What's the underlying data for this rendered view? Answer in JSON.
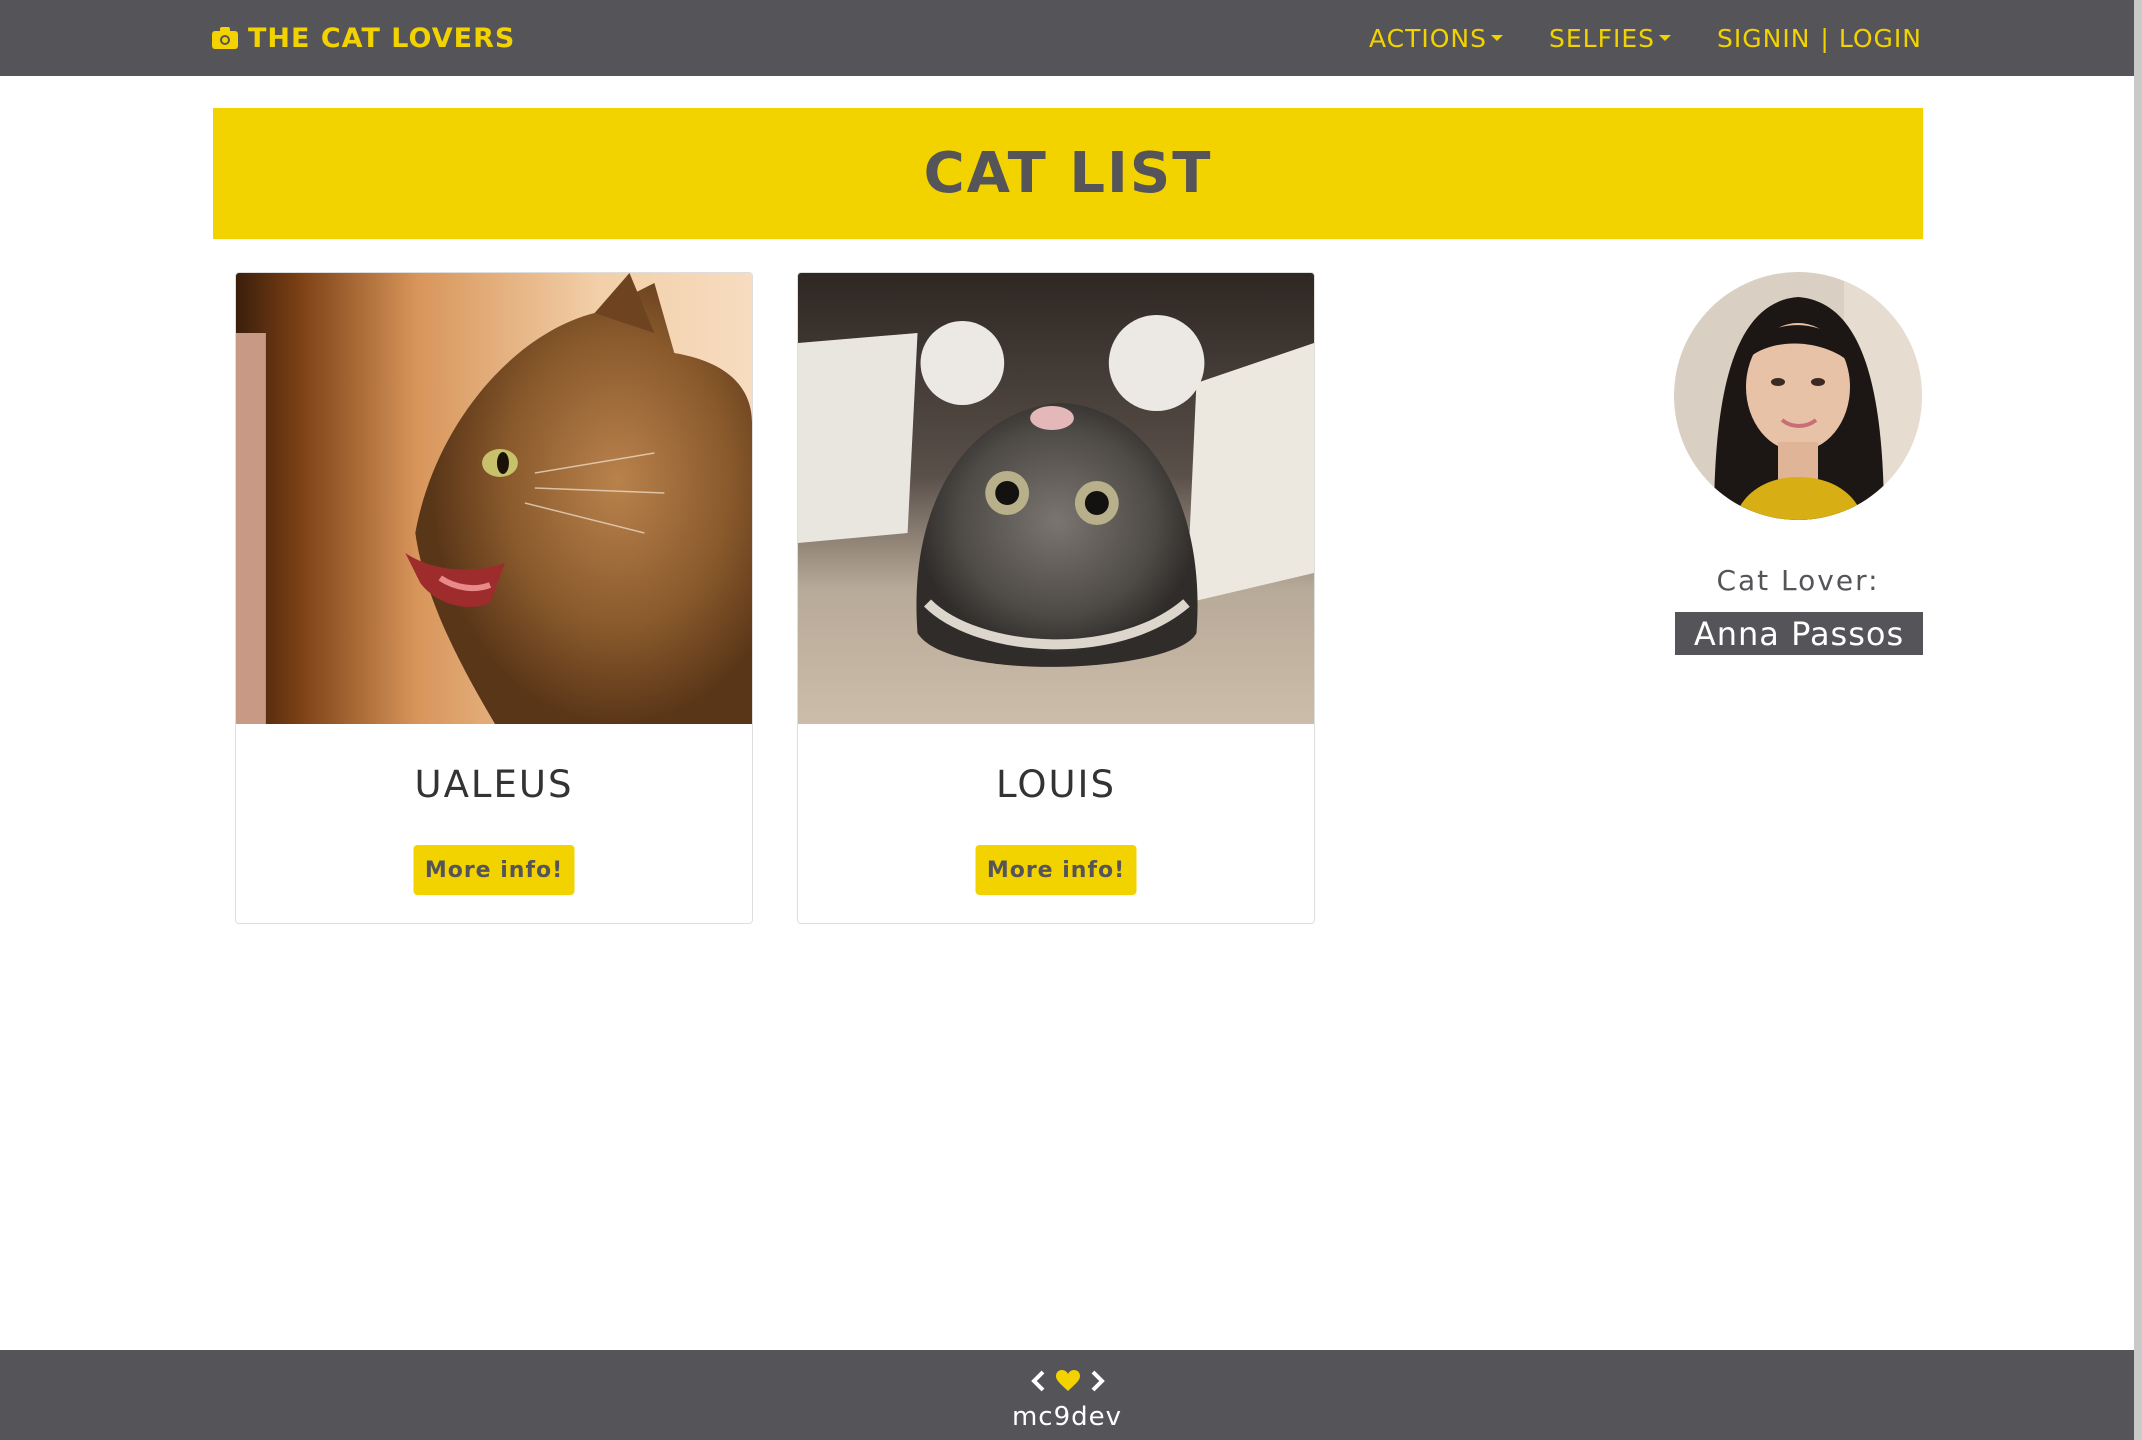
{
  "navbar": {
    "brand": "THE CAT LOVERS",
    "brand_icon": "camera-icon",
    "actions_label": "ACTIONS",
    "selfies_label": "SELFIES",
    "signin_label": "SIGNIN",
    "separator": "|",
    "login_label": "LOGIN"
  },
  "banner": {
    "title": "CAT LIST"
  },
  "cats": [
    {
      "name": "UALEUS",
      "button": "More info!"
    },
    {
      "name": "LOUIS",
      "button": "More info!"
    }
  ],
  "profile": {
    "label": "Cat Lover:",
    "name": "Anna Passos"
  },
  "footer": {
    "text": "mc9dev",
    "icons": [
      "chevron-left-icon",
      "heart-icon",
      "chevron-right-icon"
    ]
  },
  "colors": {
    "dark": "#555459",
    "accent": "#f2d300",
    "white": "#ffffff"
  }
}
